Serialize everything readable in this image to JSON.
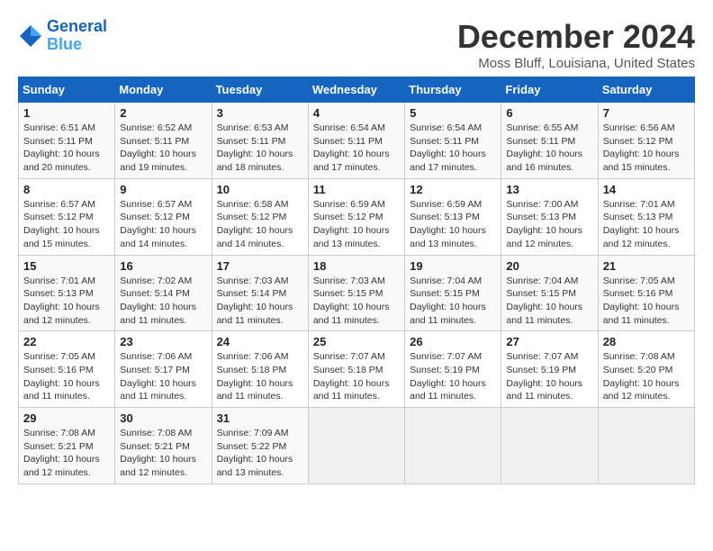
{
  "logo": {
    "line1": "General",
    "line2": "Blue"
  },
  "title": "December 2024",
  "subtitle": "Moss Bluff, Louisiana, United States",
  "days_of_week": [
    "Sunday",
    "Monday",
    "Tuesday",
    "Wednesday",
    "Thursday",
    "Friday",
    "Saturday"
  ],
  "weeks": [
    [
      {
        "day": "1",
        "info": "Sunrise: 6:51 AM\nSunset: 5:11 PM\nDaylight: 10 hours\nand 20 minutes."
      },
      {
        "day": "2",
        "info": "Sunrise: 6:52 AM\nSunset: 5:11 PM\nDaylight: 10 hours\nand 19 minutes."
      },
      {
        "day": "3",
        "info": "Sunrise: 6:53 AM\nSunset: 5:11 PM\nDaylight: 10 hours\nand 18 minutes."
      },
      {
        "day": "4",
        "info": "Sunrise: 6:54 AM\nSunset: 5:11 PM\nDaylight: 10 hours\nand 17 minutes."
      },
      {
        "day": "5",
        "info": "Sunrise: 6:54 AM\nSunset: 5:11 PM\nDaylight: 10 hours\nand 17 minutes."
      },
      {
        "day": "6",
        "info": "Sunrise: 6:55 AM\nSunset: 5:11 PM\nDaylight: 10 hours\nand 16 minutes."
      },
      {
        "day": "7",
        "info": "Sunrise: 6:56 AM\nSunset: 5:12 PM\nDaylight: 10 hours\nand 15 minutes."
      }
    ],
    [
      {
        "day": "8",
        "info": "Sunrise: 6:57 AM\nSunset: 5:12 PM\nDaylight: 10 hours\nand 15 minutes."
      },
      {
        "day": "9",
        "info": "Sunrise: 6:57 AM\nSunset: 5:12 PM\nDaylight: 10 hours\nand 14 minutes."
      },
      {
        "day": "10",
        "info": "Sunrise: 6:58 AM\nSunset: 5:12 PM\nDaylight: 10 hours\nand 14 minutes."
      },
      {
        "day": "11",
        "info": "Sunrise: 6:59 AM\nSunset: 5:12 PM\nDaylight: 10 hours\nand 13 minutes."
      },
      {
        "day": "12",
        "info": "Sunrise: 6:59 AM\nSunset: 5:13 PM\nDaylight: 10 hours\nand 13 minutes."
      },
      {
        "day": "13",
        "info": "Sunrise: 7:00 AM\nSunset: 5:13 PM\nDaylight: 10 hours\nand 12 minutes."
      },
      {
        "day": "14",
        "info": "Sunrise: 7:01 AM\nSunset: 5:13 PM\nDaylight: 10 hours\nand 12 minutes."
      }
    ],
    [
      {
        "day": "15",
        "info": "Sunrise: 7:01 AM\nSunset: 5:13 PM\nDaylight: 10 hours\nand 12 minutes."
      },
      {
        "day": "16",
        "info": "Sunrise: 7:02 AM\nSunset: 5:14 PM\nDaylight: 10 hours\nand 11 minutes."
      },
      {
        "day": "17",
        "info": "Sunrise: 7:03 AM\nSunset: 5:14 PM\nDaylight: 10 hours\nand 11 minutes."
      },
      {
        "day": "18",
        "info": "Sunrise: 7:03 AM\nSunset: 5:15 PM\nDaylight: 10 hours\nand 11 minutes."
      },
      {
        "day": "19",
        "info": "Sunrise: 7:04 AM\nSunset: 5:15 PM\nDaylight: 10 hours\nand 11 minutes."
      },
      {
        "day": "20",
        "info": "Sunrise: 7:04 AM\nSunset: 5:15 PM\nDaylight: 10 hours\nand 11 minutes."
      },
      {
        "day": "21",
        "info": "Sunrise: 7:05 AM\nSunset: 5:16 PM\nDaylight: 10 hours\nand 11 minutes."
      }
    ],
    [
      {
        "day": "22",
        "info": "Sunrise: 7:05 AM\nSunset: 5:16 PM\nDaylight: 10 hours\nand 11 minutes."
      },
      {
        "day": "23",
        "info": "Sunrise: 7:06 AM\nSunset: 5:17 PM\nDaylight: 10 hours\nand 11 minutes."
      },
      {
        "day": "24",
        "info": "Sunrise: 7:06 AM\nSunset: 5:18 PM\nDaylight: 10 hours\nand 11 minutes."
      },
      {
        "day": "25",
        "info": "Sunrise: 7:07 AM\nSunset: 5:18 PM\nDaylight: 10 hours\nand 11 minutes."
      },
      {
        "day": "26",
        "info": "Sunrise: 7:07 AM\nSunset: 5:19 PM\nDaylight: 10 hours\nand 11 minutes."
      },
      {
        "day": "27",
        "info": "Sunrise: 7:07 AM\nSunset: 5:19 PM\nDaylight: 10 hours\nand 11 minutes."
      },
      {
        "day": "28",
        "info": "Sunrise: 7:08 AM\nSunset: 5:20 PM\nDaylight: 10 hours\nand 12 minutes."
      }
    ],
    [
      {
        "day": "29",
        "info": "Sunrise: 7:08 AM\nSunset: 5:21 PM\nDaylight: 10 hours\nand 12 minutes."
      },
      {
        "day": "30",
        "info": "Sunrise: 7:08 AM\nSunset: 5:21 PM\nDaylight: 10 hours\nand 12 minutes."
      },
      {
        "day": "31",
        "info": "Sunrise: 7:09 AM\nSunset: 5:22 PM\nDaylight: 10 hours\nand 13 minutes."
      },
      {
        "day": "",
        "info": ""
      },
      {
        "day": "",
        "info": ""
      },
      {
        "day": "",
        "info": ""
      },
      {
        "day": "",
        "info": ""
      }
    ]
  ]
}
